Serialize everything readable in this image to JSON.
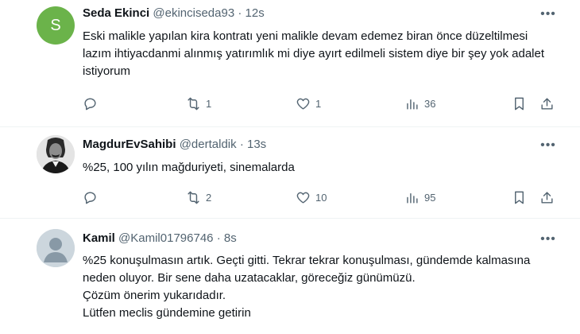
{
  "tweets": [
    {
      "avatar_letter": "S",
      "name": "Seda Ekinci",
      "handle": "@ekinciseda93",
      "separator": "·",
      "time": "12s",
      "text": "Eski malikle yapılan kira kontratı yeni malikle devam edemez biran önce düzeltilmesi lazım ihtiyacdanmi alınmış yatırımlık mi diye ayırt edilmeli sistem diye bir şey yok adalet istiyorum",
      "reply_count": "",
      "retweet_count": "1",
      "like_count": "1",
      "view_count": "36"
    },
    {
      "avatar_letter": "",
      "name": "MagdurEvSahibi",
      "handle": "@dertaldik",
      "separator": "·",
      "time": "13s",
      "text": "%25, 100 yılın mağduriyeti, sinemalarda",
      "reply_count": "",
      "retweet_count": "2",
      "like_count": "10",
      "view_count": "95"
    },
    {
      "avatar_letter": "",
      "name": "Kamil",
      "handle": "@Kamil01796746",
      "separator": "·",
      "time": "8s",
      "text": "%25 konuşulmasın artık. Geçti gitti. Tekrar tekrar konuşulması, gündemde kalmasına neden oluyor. Bir sene daha uzatacaklar, göreceğiz günümüzü.\nÇözüm önerim yukarıdadır.\nLütfen meclis gündemine getirin"
    }
  ],
  "icons": {
    "more": "more-icon",
    "reply": "reply-icon",
    "retweet": "retweet-icon",
    "like": "like-icon",
    "views": "views-icon",
    "bookmark": "bookmark-icon",
    "share": "share-icon"
  },
  "colors": {
    "avatar_s": "#6bb34a",
    "text": "#0f1419",
    "secondary": "#536471",
    "divider": "#eff3f4"
  }
}
